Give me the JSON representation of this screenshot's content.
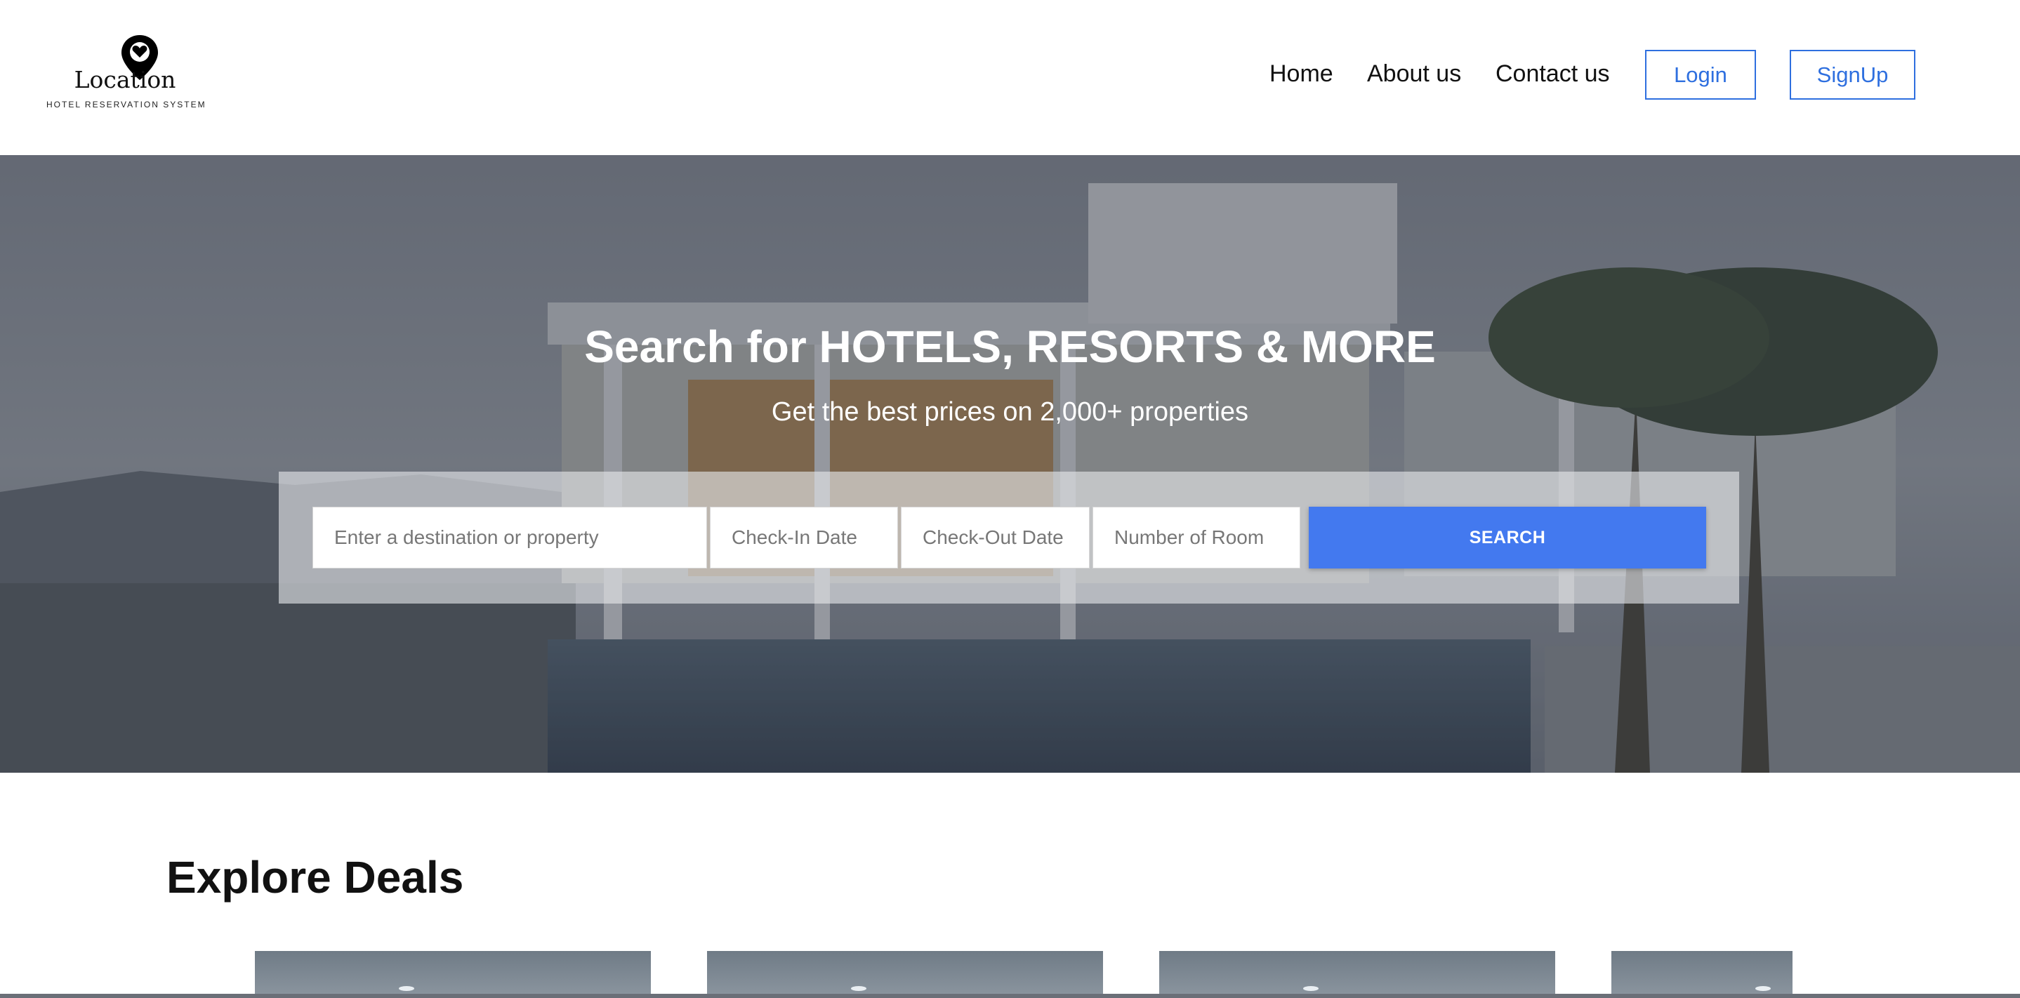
{
  "brand": {
    "name": "Location",
    "tagline": "HOTEL RESERVATION SYSTEM",
    "logo_icon": "map-pin-heart-icon"
  },
  "nav": {
    "items": [
      {
        "label": "Home"
      },
      {
        "label": "About us"
      },
      {
        "label": "Contact us"
      }
    ],
    "login_label": "Login",
    "signup_label": "SignUp"
  },
  "hero": {
    "title": "Search for HOTELS, RESORTS & MORE",
    "subtitle": "Get the best prices on 2,000+ properties",
    "search": {
      "destination_placeholder": "Enter a destination or property",
      "checkin_placeholder": "Check-In Date",
      "checkout_placeholder": "Check-Out Date",
      "rooms_placeholder": "Number of Room",
      "button_label": "SEARCH"
    }
  },
  "deals": {
    "title": "Explore Deals",
    "cards": [
      {
        "id": 1
      },
      {
        "id": 2
      },
      {
        "id": 3
      },
      {
        "id": 4
      }
    ]
  },
  "colors": {
    "accent": "#4379ef",
    "nav_button_border": "#2e6fdf",
    "text": "#111111"
  }
}
